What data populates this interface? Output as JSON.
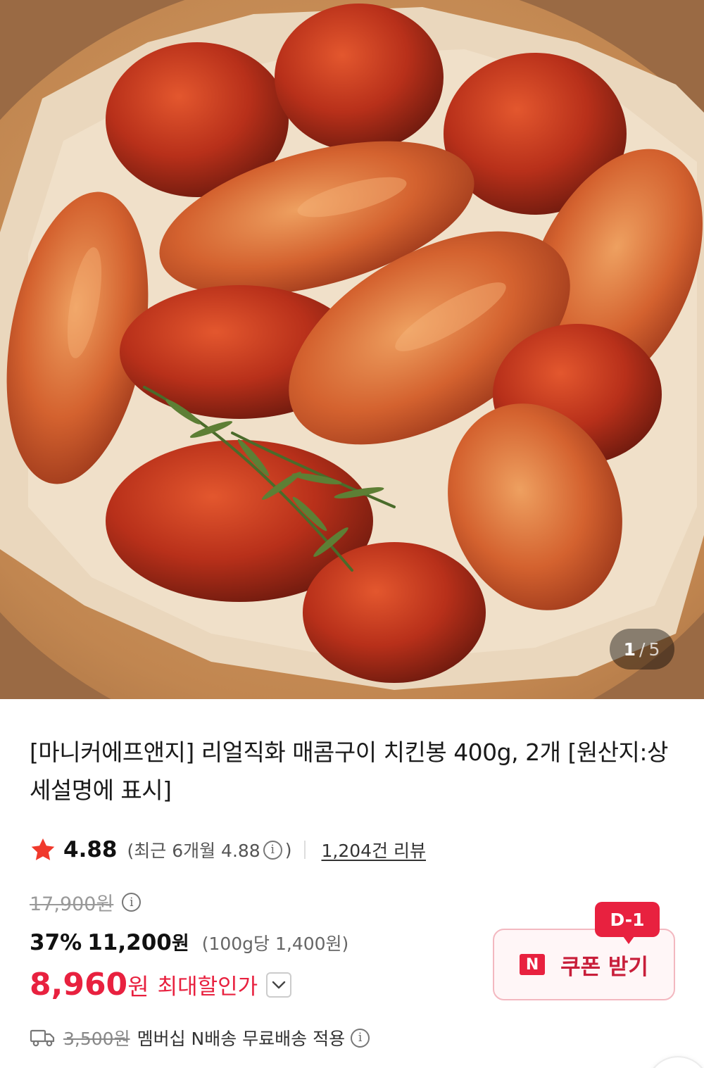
{
  "gallery": {
    "current": "1",
    "separator": "/",
    "total": "5"
  },
  "product": {
    "title": "[마니커에프앤지] 리얼직화 매콤구이 치킨봉 400g, 2개 [원산지:상세설명에 표시]"
  },
  "rating": {
    "value": "4.88",
    "recent_open": "(최근 6개월 4.88",
    "info_glyph": "i",
    "recent_close": ")",
    "reviews": "1,204건 리뷰"
  },
  "price": {
    "original": "17,900원",
    "discount_rate": "37%",
    "sale_number": "11,200",
    "sale_unit": "원",
    "unit_price": "(100g당 1,400원)",
    "final_number": "8,960",
    "final_unit": "원",
    "final_label": "최대할인가"
  },
  "coupon": {
    "badge": "D-1",
    "n_logo": "N",
    "label": "쿠폰 받기"
  },
  "shipping": {
    "original_fee": "3,500원",
    "text": "멤버십 N배송 무료배송 적용"
  },
  "colors": {
    "accent_red": "#e8213f",
    "star": "#f0392c"
  },
  "icons": {
    "rating": "star-icon",
    "info": "info-icon",
    "shipping": "truck-icon",
    "expand": "chevron-down-icon"
  }
}
